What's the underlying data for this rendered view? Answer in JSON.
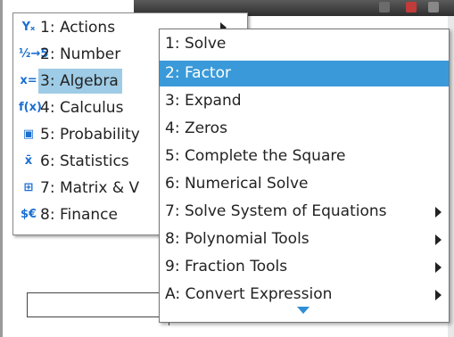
{
  "menu": {
    "items": [
      {
        "icon": "actions-icon",
        "glyph": "Yₓ",
        "label": "1: Actions",
        "has_sub": true
      },
      {
        "icon": "number-icon",
        "glyph": "½→5",
        "label": "2: Number"
      },
      {
        "icon": "algebra-icon",
        "glyph": "x=",
        "label": "3: Algebra",
        "selected": true
      },
      {
        "icon": "calculus-icon",
        "glyph": "f(x)",
        "label": "4: Calculus"
      },
      {
        "icon": "probability-icon",
        "glyph": "▣",
        "label": "5: Probability"
      },
      {
        "icon": "statistics-icon",
        "glyph": "x̄",
        "label": "6: Statistics"
      },
      {
        "icon": "matrix-icon",
        "glyph": "⊞",
        "label": "7: Matrix & V"
      },
      {
        "icon": "finance-icon",
        "glyph": "$€",
        "label": "8: Finance"
      }
    ]
  },
  "submenu": {
    "items": [
      {
        "label": "1: Solve"
      },
      {
        "label": "2: Factor",
        "selected": true
      },
      {
        "label": "3: Expand"
      },
      {
        "label": "4: Zeros"
      },
      {
        "label": "5: Complete the Square"
      },
      {
        "label": "6: Numerical Solve"
      },
      {
        "label": "7: Solve System of Equations",
        "has_sub": true
      },
      {
        "label": "8: Polynomial Tools",
        "has_sub": true
      },
      {
        "label": "9: Fraction Tools",
        "has_sub": true
      },
      {
        "label": "A: Convert Expression",
        "has_sub": true
      }
    ]
  },
  "colors": {
    "selected_primary_bg": "#9ecbe5",
    "selected_submenu_bg": "#3a9ad9",
    "icon_color": "#1a6fd0",
    "scroll_arrow": "#2f8fd6"
  }
}
